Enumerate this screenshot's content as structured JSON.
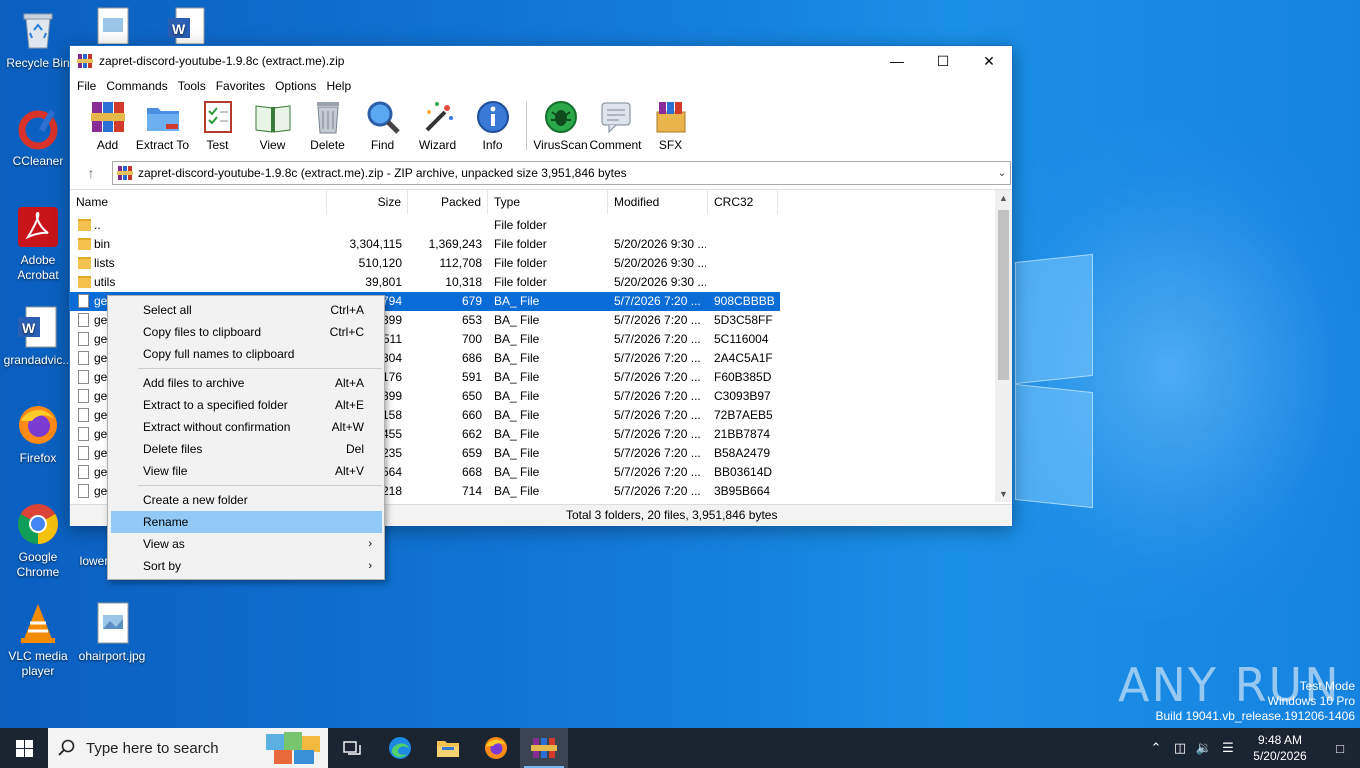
{
  "desktop": {
    "icons": [
      {
        "label": "Recycle Bin"
      },
      {
        "label": "CCleaner"
      },
      {
        "label": "Adobe Acrobat"
      },
      {
        "label": "grandadvic..."
      },
      {
        "label": "Firefox"
      },
      {
        "label": "Google Chrome"
      },
      {
        "label": "VLC media player"
      },
      {
        "label": "ohairport.jpg"
      },
      {
        "label": "lower"
      }
    ],
    "watermark": "ANY RUN",
    "testmode_line1": "Test Mode",
    "testmode_line2": "Windows 10 Pro",
    "testmode_line3": "Build 19041.vb_release.191206-1406"
  },
  "window": {
    "title": "zapret-discord-youtube-1.9.8c (extract.me).zip",
    "menu": [
      "File",
      "Commands",
      "Tools",
      "Favorites",
      "Options",
      "Help"
    ],
    "toolbar": [
      "Add",
      "Extract To",
      "Test",
      "View",
      "Delete",
      "Find",
      "Wizard",
      "Info",
      "VirusScan",
      "Comment",
      "SFX"
    ],
    "address": "zapret-discord-youtube-1.9.8c (extract.me).zip - ZIP archive, unpacked size 3,951,846 bytes",
    "columns": [
      "Name",
      "Size",
      "Packed",
      "Type",
      "Modified",
      "CRC32"
    ],
    "rows": [
      {
        "name": "..",
        "size": "",
        "packed": "",
        "type": "File folder",
        "modified": "",
        "crc": "",
        "kind": "folder"
      },
      {
        "name": "bin",
        "size": "3,304,115",
        "packed": "1,369,243",
        "type": "File folder",
        "modified": "5/20/2026 9:30 ...",
        "crc": "",
        "kind": "folder"
      },
      {
        "name": "lists",
        "size": "510,120",
        "packed": "112,708",
        "type": "File folder",
        "modified": "5/20/2026 9:30 ...",
        "crc": "",
        "kind": "folder"
      },
      {
        "name": "utils",
        "size": "39,801",
        "packed": "10,318",
        "type": "File folder",
        "modified": "5/20/2026 9:30 ...",
        "crc": "",
        "kind": "folder"
      },
      {
        "name": "ge",
        "size": "794",
        "packed": "679",
        "type": "BA_ File",
        "modified": "5/7/2026 7:20 ...",
        "crc": "908CBBBB",
        "kind": "file"
      },
      {
        "name": "ge",
        "size": "399",
        "packed": "653",
        "type": "BA_ File",
        "modified": "5/7/2026 7:20 ...",
        "crc": "5D3C58FF",
        "kind": "file"
      },
      {
        "name": "ge",
        "size": "511",
        "packed": "700",
        "type": "BA_ File",
        "modified": "5/7/2026 7:20 ...",
        "crc": "5C116004",
        "kind": "file"
      },
      {
        "name": "ge",
        "size": "304",
        "packed": "686",
        "type": "BA_ File",
        "modified": "5/7/2026 7:20 ...",
        "crc": "2A4C5A1F",
        "kind": "file"
      },
      {
        "name": "ge",
        "size": "176",
        "packed": "591",
        "type": "BA_ File",
        "modified": "5/7/2026 7:20 ...",
        "crc": "F60B385D",
        "kind": "file"
      },
      {
        "name": "ge",
        "size": "399",
        "packed": "650",
        "type": "BA_ File",
        "modified": "5/7/2026 7:20 ...",
        "crc": "C3093B97",
        "kind": "file"
      },
      {
        "name": "ge",
        "size": "158",
        "packed": "660",
        "type": "BA_ File",
        "modified": "5/7/2026 7:20 ...",
        "crc": "72B7AEB5",
        "kind": "file"
      },
      {
        "name": "ge",
        "size": "455",
        "packed": "662",
        "type": "BA_ File",
        "modified": "5/7/2026 7:20 ...",
        "crc": "21BB7874",
        "kind": "file"
      },
      {
        "name": "ge",
        "size": "235",
        "packed": "659",
        "type": "BA_ File",
        "modified": "5/7/2026 7:20 ...",
        "crc": "B58A2479",
        "kind": "file"
      },
      {
        "name": "ge",
        "size": "564",
        "packed": "668",
        "type": "BA_ File",
        "modified": "5/7/2026 7:20 ...",
        "crc": "BB03614D",
        "kind": "file"
      },
      {
        "name": "ge",
        "size": "218",
        "packed": "714",
        "type": "BA_ File",
        "modified": "5/7/2026 7:20 ...",
        "crc": "3B95B664",
        "kind": "file"
      }
    ],
    "status": "Total 3 folders, 20 files, 3,951,846 bytes"
  },
  "context_menu": {
    "items": [
      {
        "label": "Select all",
        "shortcut": "Ctrl+A"
      },
      {
        "label": "Copy files to clipboard",
        "shortcut": "Ctrl+C"
      },
      {
        "label": "Copy full names to clipboard",
        "shortcut": ""
      },
      {
        "label": "Add files to archive",
        "shortcut": "Alt+A"
      },
      {
        "label": "Extract to a specified folder",
        "shortcut": "Alt+E"
      },
      {
        "label": "Extract without confirmation",
        "shortcut": "Alt+W"
      },
      {
        "label": "Delete files",
        "shortcut": "Del"
      },
      {
        "label": "View file",
        "shortcut": "Alt+V"
      },
      {
        "label": "Create a new folder",
        "shortcut": ""
      },
      {
        "label": "Rename",
        "shortcut": ""
      },
      {
        "label": "View as",
        "shortcut": ""
      },
      {
        "label": "Sort by",
        "shortcut": ""
      }
    ],
    "highlighted": "Rename"
  },
  "taskbar": {
    "search_placeholder": "Type here to search",
    "time": "9:48 AM",
    "date": "5/20/2026"
  },
  "colors": {
    "selection": "#0a6cd6",
    "menu_highlight": "#91c9f7",
    "taskbar": "#1b2431"
  }
}
